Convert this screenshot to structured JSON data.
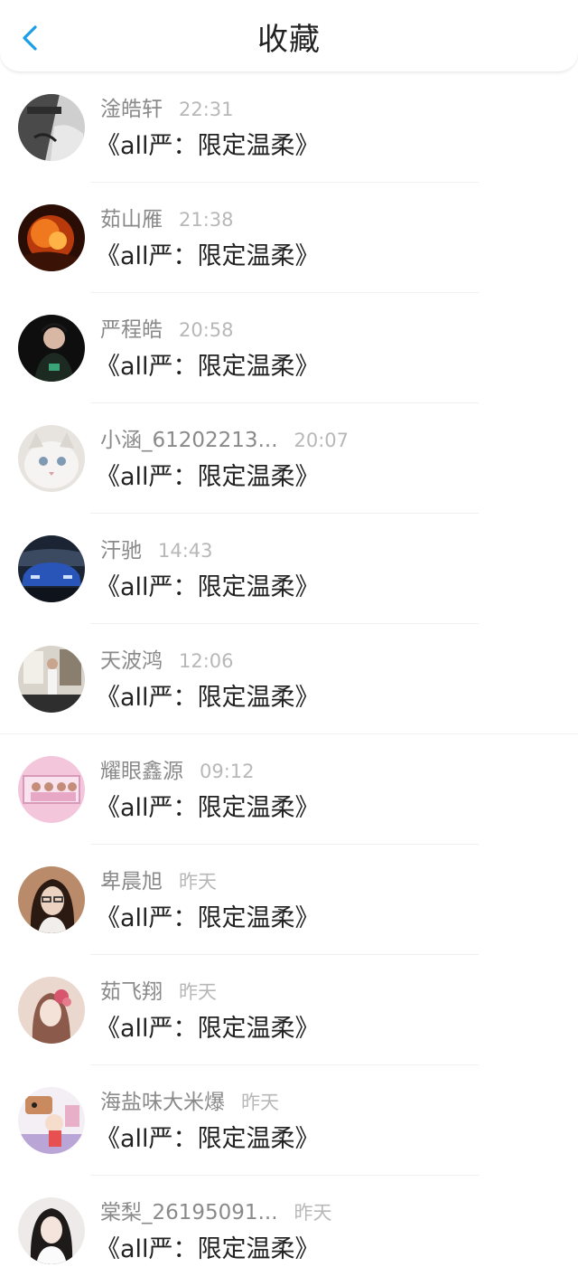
{
  "header": {
    "title": "收藏",
    "back_icon": "chevron-left-icon",
    "accent_color": "#1a9ee8"
  },
  "items": [
    {
      "name": "淦皓轩",
      "time": "22:31",
      "message": "《all严：限定温柔》",
      "avatar": "avatar-dark-text"
    },
    {
      "name": "茹山雁",
      "time": "21:38",
      "message": "《all严：限定温柔》",
      "avatar": "avatar-fire"
    },
    {
      "name": "严程皓",
      "time": "20:58",
      "message": "《all严：限定温柔》",
      "avatar": "avatar-person-dark"
    },
    {
      "name": "小涵_61202213...",
      "time": "20:07",
      "message": "《all严：限定温柔》",
      "avatar": "avatar-cat"
    },
    {
      "name": "汗驰",
      "time": "14:43",
      "message": "《all严：限定温柔》",
      "avatar": "avatar-car"
    },
    {
      "name": "天波鸿",
      "time": "12:06",
      "message": "《all严：限定温柔》",
      "avatar": "avatar-room"
    },
    {
      "name": "耀眼鑫源",
      "time": "09:12",
      "message": "《all严：限定温柔》",
      "avatar": "avatar-pink-group"
    },
    {
      "name": "卑晨旭",
      "time": "昨天",
      "message": "《all严：限定温柔》",
      "avatar": "avatar-girl-glasses"
    },
    {
      "name": "茹飞翔",
      "time": "昨天",
      "message": "《all严：限定温柔》",
      "avatar": "avatar-flower-girl"
    },
    {
      "name": "海盐味大米爆",
      "time": "昨天",
      "message": "《all严：限定温柔》",
      "avatar": "avatar-cartoon"
    },
    {
      "name": "棠梨_26195091...",
      "time": "昨天",
      "message": "《all严：限定温柔》",
      "avatar": "avatar-girl-white"
    }
  ]
}
